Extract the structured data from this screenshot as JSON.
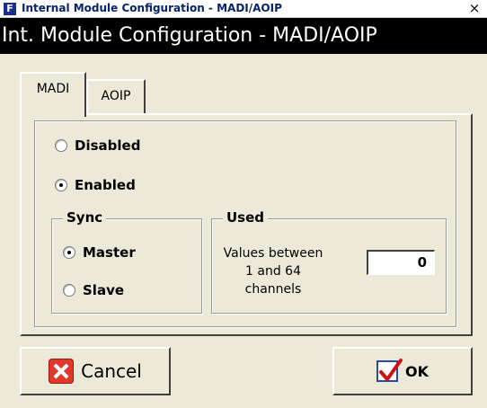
{
  "window": {
    "app_icon_letter": "F",
    "title": "Internal Module Configuration - MADI/AOIP",
    "close_symbol": "×"
  },
  "header": {
    "title": "Int. Module Configuration - MADI/AOIP"
  },
  "tabs": [
    {
      "label": "MADI",
      "active": true
    },
    {
      "label": "AOIP",
      "active": false
    }
  ],
  "madi": {
    "state_options": [
      {
        "label": "Disabled",
        "checked": false
      },
      {
        "label": "Enabled",
        "checked": true
      }
    ],
    "sync": {
      "title": "Sync",
      "options": [
        {
          "label": "Master",
          "checked": true
        },
        {
          "label": "Slave",
          "checked": false
        }
      ]
    },
    "used": {
      "title": "Used",
      "description": "Values between 1 and 64 channels",
      "value": "0"
    }
  },
  "buttons": {
    "cancel_label": "Cancel",
    "cancel_icon": "red-x-icon",
    "ok_label": "OK",
    "ok_icon": "checkmark-icon"
  },
  "colors": {
    "window_bg": "#ece9d8",
    "header_bg": "#000000",
    "header_text": "#ffffff",
    "title_text": "#0a246a",
    "cancel_icon": "#e0382a",
    "ok_check": "#d01010"
  }
}
